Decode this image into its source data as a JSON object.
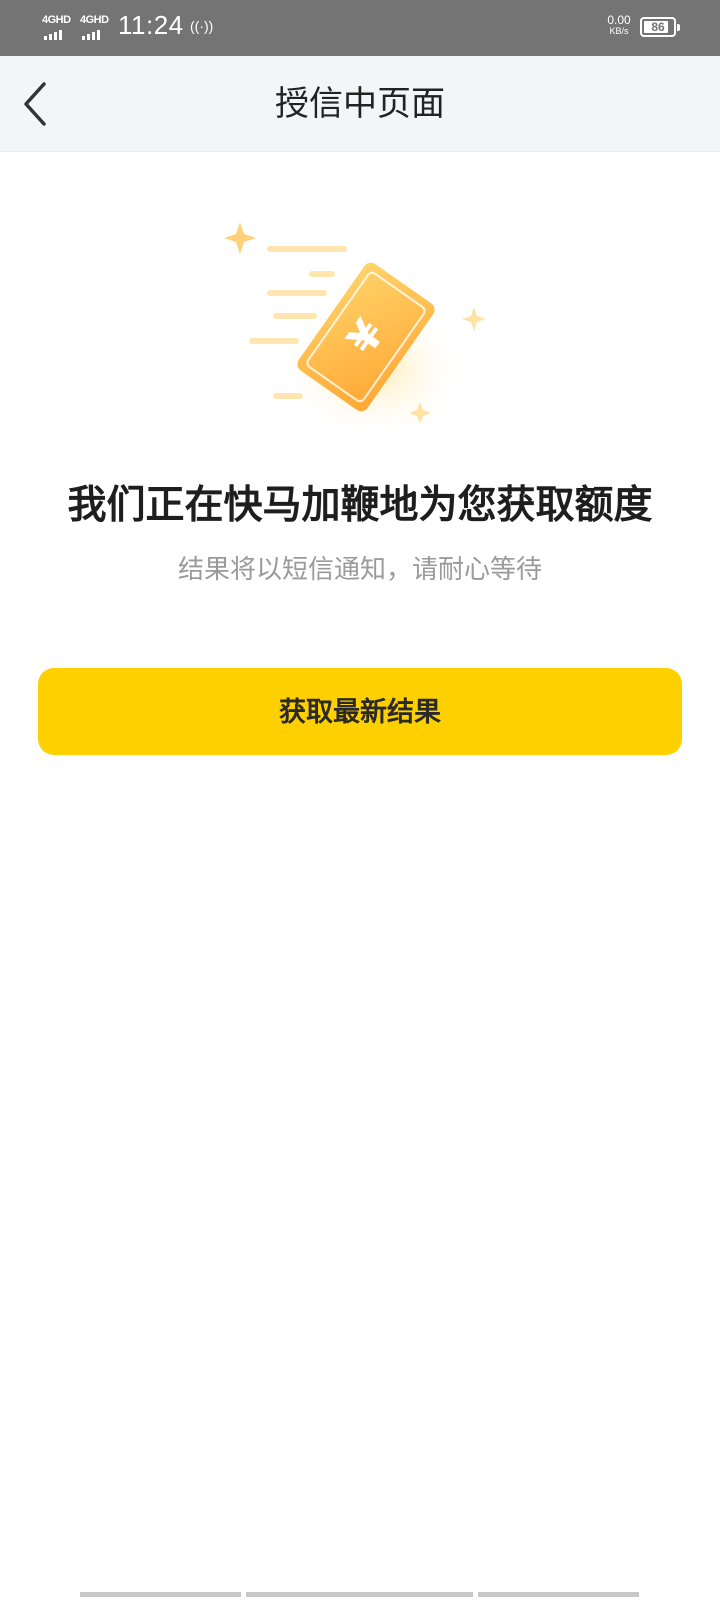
{
  "status_bar": {
    "network_1": "4GHD",
    "network_2": "4GHD",
    "time": "11:24",
    "hotspot_symbol": "((·))",
    "speed_value": "0.00",
    "speed_unit": "KB/s",
    "battery_level": "86"
  },
  "nav": {
    "back_icon": "chevron-left-icon",
    "title": "授信中页面"
  },
  "illustration": {
    "card_symbol": "¥",
    "accent_color": "#ffb938"
  },
  "main": {
    "headline": "我们正在快马加鞭地为您获取额度",
    "subtext": "结果将以短信通知，请耐心等待",
    "button_label": "获取最新结果",
    "button_color": "#ffd000"
  }
}
